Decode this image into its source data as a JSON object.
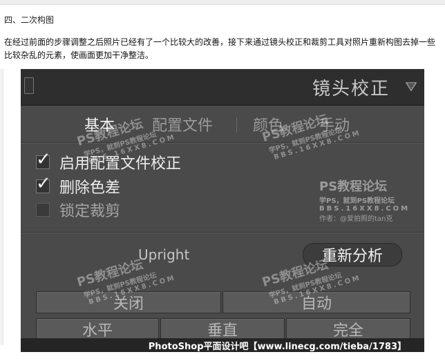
{
  "article": {
    "section_title": "四、二次构图",
    "paragraph": "在经过前面的步骤调整之后照片已经有了一个比较大的改善，接下来通过镜头校正和裁剪工具对照片重新构图去掉一些比较杂乱的元素，使画面更加干净整洁。"
  },
  "panel": {
    "title": "镜头校正",
    "tabs": [
      {
        "label": "基本",
        "active": true
      },
      {
        "label": "配置文件",
        "active": false
      },
      {
        "label": "颜色",
        "active": false
      },
      {
        "label": "手动",
        "active": false
      }
    ],
    "checkboxes": [
      {
        "label": "启用配置文件校正",
        "checked": true
      },
      {
        "label": "删除色差",
        "checked": true
      },
      {
        "label": "锁定裁剪",
        "checked": false
      }
    ],
    "checkmark_glyph": "✓",
    "upright_label": "Upright",
    "reanalyze_label": "重新分析",
    "upright_buttons_row1": [
      "关闭",
      "自动"
    ],
    "upright_buttons_row2": [
      "水平",
      "垂直",
      "完全"
    ]
  },
  "watermarks": {
    "line1": "PS教程论坛",
    "line2": "学PS，就到PS教程论坛",
    "line3": "BBS.16XX8.COM",
    "author": "作者：@爱拍照的tan克"
  },
  "footer": {
    "credit": "PhotoShop平面设计吧【www.linecg.com/tieba/1783】"
  },
  "colors": {
    "panel_bg": "#4a4a4a",
    "header_bg": "#2e2e2e",
    "active_text": "#f2f2f2",
    "inactive_text": "#9a9a9a"
  }
}
